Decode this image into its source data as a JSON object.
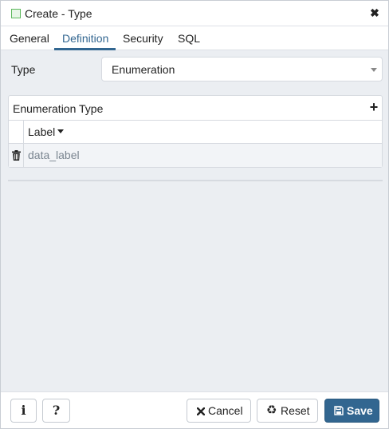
{
  "dialog": {
    "title": "Create - Type",
    "title_icon": "type-icon",
    "close_icon": "close-icon"
  },
  "tabs": [
    {
      "label": "General",
      "active": false
    },
    {
      "label": "Definition",
      "active": true
    },
    {
      "label": "Security",
      "active": false
    },
    {
      "label": "SQL",
      "active": false
    }
  ],
  "form": {
    "type_label": "Type",
    "type_value": "Enumeration"
  },
  "grid": {
    "title": "Enumeration Type",
    "add_icon": "plus-icon",
    "column_label": "Label",
    "rows": [
      {
        "label": "data_label",
        "delete_icon": "trash-icon"
      }
    ]
  },
  "footer": {
    "info_icon": "info-icon",
    "help_icon": "question-icon",
    "info_glyph": "i",
    "help_glyph": "?",
    "cancel_label": "Cancel",
    "reset_label": "Reset",
    "save_label": "Save"
  },
  "colors": {
    "accent": "#326690",
    "background": "#ebeef2",
    "border": "#d6dae0"
  }
}
